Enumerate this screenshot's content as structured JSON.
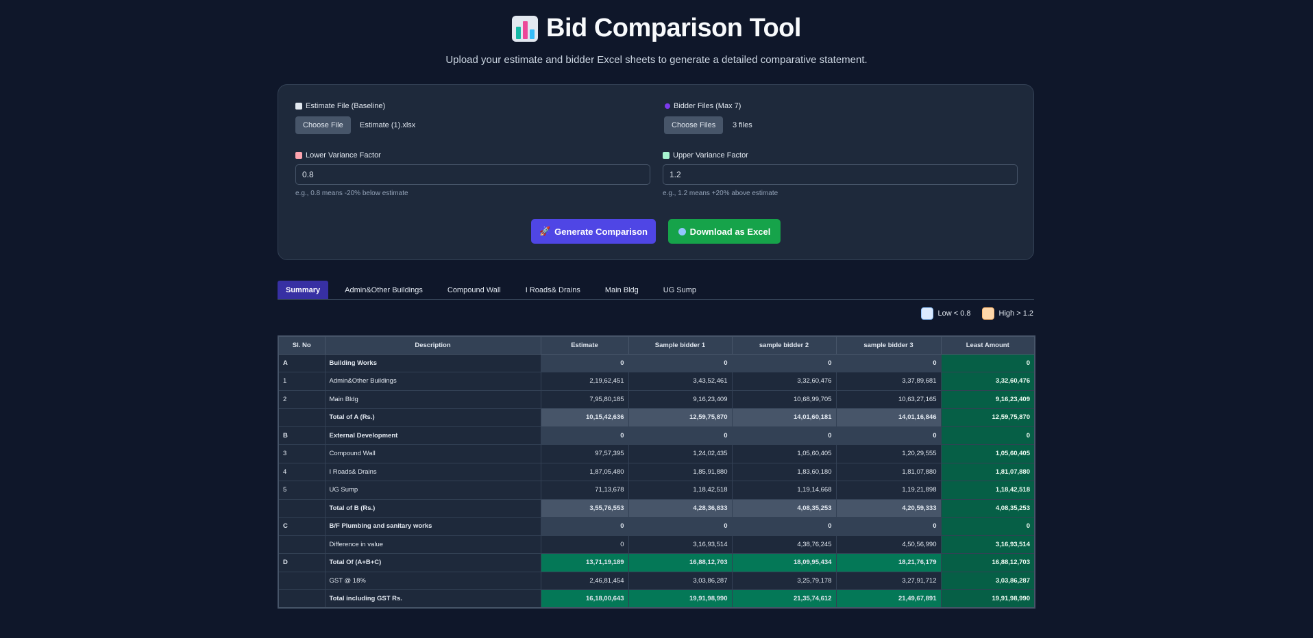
{
  "header": {
    "icon": "bar-chart-icon",
    "title": "Bid Comparison Tool",
    "subtitle": "Upload your estimate and bidder Excel sheets to generate a detailed comparative statement."
  },
  "form": {
    "estimate": {
      "label": "Estimate File (Baseline)",
      "icon": "document-icon",
      "button": "Choose File",
      "file_name": "Estimate (1).xlsx"
    },
    "bidders": {
      "label": "Bidder Files (Max 7)",
      "icon": "people-icon",
      "button": "Choose Files",
      "file_name": "3 files"
    },
    "lower": {
      "label": "Lower Variance Factor",
      "icon": "chart-down-icon",
      "value": "0.8",
      "hint": "e.g., 0.8 means -20% below estimate"
    },
    "upper": {
      "label": "Upper Variance Factor",
      "icon": "chart-up-icon",
      "value": "1.2",
      "hint": "e.g., 1.2 means +20% above estimate"
    },
    "generate_label": "Generate Comparison",
    "download_label": "Download as Excel"
  },
  "tabs": [
    "Summary",
    "Admin&Other Buildings",
    "Compound Wall",
    "I Roads& Drains",
    "Main Bldg",
    "UG Sump"
  ],
  "active_tab": "Summary",
  "legend": {
    "low": "Low < 0.8",
    "high": "High > 1.2"
  },
  "colors": {
    "accent": "#4f46e5",
    "download": "#16a34a",
    "least": "#065f46",
    "background": "#0f172a"
  },
  "table": {
    "columns": [
      "Sl. No",
      "Description",
      "Estimate",
      "Sample bidder 1",
      "sample bidder 2",
      "sample bidder 3",
      "Least Amount"
    ],
    "rows": [
      {
        "sl": "A",
        "desc": "Building Works",
        "vals": [
          "0",
          "0",
          "0",
          "0"
        ],
        "least": "0",
        "style": "hdr"
      },
      {
        "sl": "1",
        "desc": "Admin&Other Buildings",
        "vals": [
          "2,19,62,451",
          "3,43,52,461",
          "3,32,60,476",
          "3,37,89,681"
        ],
        "least": "3,32,60,476",
        "style": "normal"
      },
      {
        "sl": "2",
        "desc": "Main Bldg",
        "vals": [
          "7,95,80,185",
          "9,16,23,409",
          "10,68,99,705",
          "10,63,27,165"
        ],
        "least": "9,16,23,409",
        "style": "normal"
      },
      {
        "sl": "",
        "desc": "Total of A (Rs.)",
        "vals": [
          "10,15,42,636",
          "12,59,75,870",
          "14,01,60,181",
          "14,01,16,846"
        ],
        "least": "12,59,75,870",
        "style": "sub"
      },
      {
        "sl": "B",
        "desc": "External Development",
        "vals": [
          "0",
          "0",
          "0",
          "0"
        ],
        "least": "0",
        "style": "hdr"
      },
      {
        "sl": "3",
        "desc": "Compound Wall",
        "vals": [
          "97,57,395",
          "1,24,02,435",
          "1,05,60,405",
          "1,20,29,555"
        ],
        "least": "1,05,60,405",
        "style": "normal"
      },
      {
        "sl": "4",
        "desc": "I Roads& Drains",
        "vals": [
          "1,87,05,480",
          "1,85,91,880",
          "1,83,60,180",
          "1,81,07,880"
        ],
        "least": "1,81,07,880",
        "style": "normal"
      },
      {
        "sl": "5",
        "desc": "UG Sump",
        "vals": [
          "71,13,678",
          "1,18,42,518",
          "1,19,14,668",
          "1,19,21,898"
        ],
        "least": "1,18,42,518",
        "style": "normal"
      },
      {
        "sl": "",
        "desc": "Total of B (Rs.)",
        "vals": [
          "3,55,76,553",
          "4,28,36,833",
          "4,08,35,253",
          "4,20,59,333"
        ],
        "least": "4,08,35,253",
        "style": "sub"
      },
      {
        "sl": "C",
        "desc": "B/F Plumbing and sanitary works",
        "vals": [
          "0",
          "0",
          "0",
          "0"
        ],
        "least": "0",
        "style": "hdr"
      },
      {
        "sl": "",
        "desc": "Difference in value",
        "vals": [
          "0",
          "3,16,93,514",
          "4,38,76,245",
          "4,50,56,990"
        ],
        "least": "3,16,93,514",
        "style": "normal"
      },
      {
        "sl": "D",
        "desc": "Total Of (A+B+C)",
        "vals": [
          "13,71,19,189",
          "16,88,12,703",
          "18,09,95,434",
          "18,21,76,179"
        ],
        "least": "16,88,12,703",
        "style": "green"
      },
      {
        "sl": "",
        "desc": "GST @ 18%",
        "vals": [
          "2,46,81,454",
          "3,03,86,287",
          "3,25,79,178",
          "3,27,91,712"
        ],
        "least": "3,03,86,287",
        "style": "normal"
      },
      {
        "sl": "",
        "desc": "Total including GST Rs.",
        "vals": [
          "16,18,00,643",
          "19,91,98,990",
          "21,35,74,612",
          "21,49,67,891"
        ],
        "least": "19,91,98,990",
        "style": "green"
      }
    ]
  }
}
